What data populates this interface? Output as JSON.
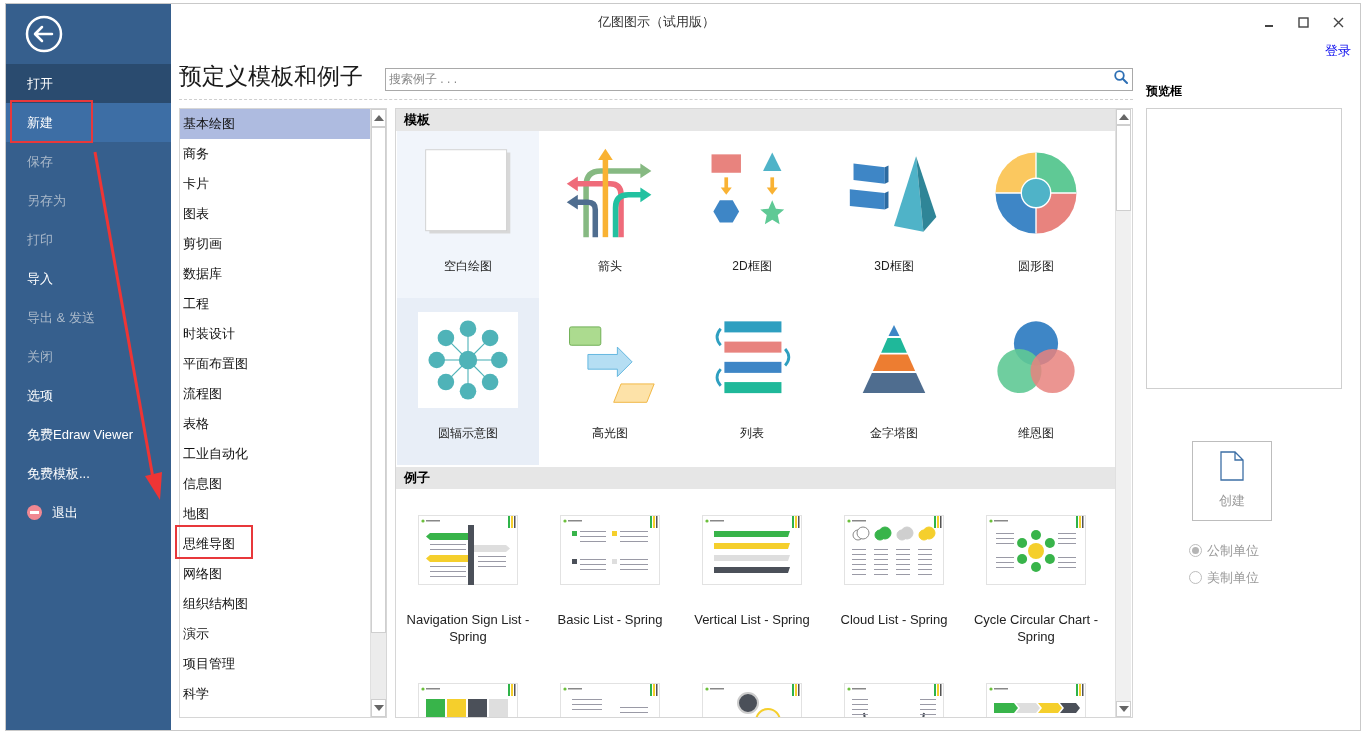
{
  "window": {
    "title": "亿图图示（试用版）"
  },
  "sidebar": {
    "items": [
      {
        "label": "打开",
        "kind": "item",
        "selected": false,
        "hovered": true,
        "disabled": false,
        "highlighted": false
      },
      {
        "label": "新建",
        "kind": "item",
        "selected": true,
        "hovered": false,
        "disabled": false,
        "highlighted": true
      },
      {
        "label": "保存",
        "kind": "item",
        "selected": false,
        "hovered": false,
        "disabled": true,
        "highlighted": false
      },
      {
        "label": "另存为",
        "kind": "item",
        "selected": false,
        "hovered": false,
        "disabled": true,
        "highlighted": false
      },
      {
        "label": "打印",
        "kind": "item",
        "selected": false,
        "hovered": false,
        "disabled": true,
        "highlighted": false
      },
      {
        "label": "导入",
        "kind": "item",
        "selected": false,
        "hovered": false,
        "disabled": false,
        "highlighted": false
      },
      {
        "label": "导出 & 发送",
        "kind": "item",
        "selected": false,
        "hovered": false,
        "disabled": true,
        "highlighted": false
      },
      {
        "label": "关闭",
        "kind": "item",
        "selected": false,
        "hovered": false,
        "disabled": true,
        "highlighted": false
      },
      {
        "label": "选项",
        "kind": "item",
        "selected": false,
        "hovered": false,
        "disabled": false,
        "highlighted": false
      },
      {
        "label": "免费Edraw Viewer",
        "kind": "item",
        "selected": false,
        "hovered": false,
        "disabled": false,
        "highlighted": false
      },
      {
        "label": "免费模板...",
        "kind": "item",
        "selected": false,
        "hovered": false,
        "disabled": false,
        "highlighted": false
      },
      {
        "label": "退出",
        "kind": "exit",
        "selected": false,
        "hovered": false,
        "disabled": false,
        "highlighted": false
      }
    ]
  },
  "header": {
    "title": "预定义模板和例子",
    "search": {
      "placeholder": "搜索例子 . . ."
    }
  },
  "categories": [
    {
      "label": "基本绘图",
      "selected": true,
      "highlighted": false
    },
    {
      "label": "商务",
      "selected": false,
      "highlighted": false
    },
    {
      "label": "卡片",
      "selected": false,
      "highlighted": false
    },
    {
      "label": "图表",
      "selected": false,
      "highlighted": false
    },
    {
      "label": "剪切画",
      "selected": false,
      "highlighted": false
    },
    {
      "label": "数据库",
      "selected": false,
      "highlighted": false
    },
    {
      "label": "工程",
      "selected": false,
      "highlighted": false
    },
    {
      "label": "时装设计",
      "selected": false,
      "highlighted": false
    },
    {
      "label": "平面布置图",
      "selected": false,
      "highlighted": false
    },
    {
      "label": "流程图",
      "selected": false,
      "highlighted": false
    },
    {
      "label": "表格",
      "selected": false,
      "highlighted": false
    },
    {
      "label": "工业自动化",
      "selected": false,
      "highlighted": false
    },
    {
      "label": "信息图",
      "selected": false,
      "highlighted": false
    },
    {
      "label": "地图",
      "selected": false,
      "highlighted": false
    },
    {
      "label": "思维导图",
      "selected": false,
      "highlighted": true
    },
    {
      "label": "网络图",
      "selected": false,
      "highlighted": false
    },
    {
      "label": "组织结构图",
      "selected": false,
      "highlighted": false
    },
    {
      "label": "演示",
      "selected": false,
      "highlighted": false
    },
    {
      "label": "项目管理",
      "selected": false,
      "highlighted": false
    },
    {
      "label": "科学",
      "selected": false,
      "highlighted": false
    }
  ],
  "templates": {
    "heading": "模板",
    "items": [
      {
        "label": "空白绘图",
        "kind": "blank",
        "selected": false,
        "hovered": true
      },
      {
        "label": "箭头",
        "kind": "arrows",
        "selected": false,
        "hovered": false
      },
      {
        "label": "2D框图",
        "kind": "blocks2d",
        "selected": false,
        "hovered": false
      },
      {
        "label": "3D框图",
        "kind": "blocks3d",
        "selected": false,
        "hovered": false
      },
      {
        "label": "圆形图",
        "kind": "circle",
        "selected": false,
        "hovered": false
      },
      {
        "label": "圆辐示意图",
        "kind": "spoke",
        "selected": true,
        "hovered": false
      },
      {
        "label": "高光图",
        "kind": "highlight",
        "selected": false,
        "hovered": false
      },
      {
        "label": "列表",
        "kind": "list",
        "selected": false,
        "hovered": false
      },
      {
        "label": "金字塔图",
        "kind": "pyramid",
        "selected": false,
        "hovered": false
      },
      {
        "label": "维恩图",
        "kind": "venn",
        "selected": false,
        "hovered": false
      }
    ]
  },
  "examples": {
    "heading": "例子",
    "items": [
      {
        "title": "Navigation Sign List - Spring",
        "kind": "sign"
      },
      {
        "title": "Basic List - Spring",
        "kind": "list"
      },
      {
        "title": "Vertical List - Spring",
        "kind": "vertical"
      },
      {
        "title": "Cloud List - Spring",
        "kind": "cloud"
      },
      {
        "title": "Cycle Circular Chart - Spring",
        "kind": "cycle"
      },
      {
        "kind": "columns"
      },
      {
        "kind": "pie"
      },
      {
        "kind": "circles"
      },
      {
        "kind": "frame"
      },
      {
        "kind": "chevrons"
      }
    ]
  },
  "login": "登录",
  "preview": {
    "title": "预览框"
  },
  "create_button": {
    "label": "创建",
    "disabled": true
  },
  "units": [
    {
      "label": "公制单位",
      "selected": true,
      "disabled": true
    },
    {
      "label": "美制单位",
      "selected": false,
      "disabled": true
    }
  ],
  "annotations": {
    "arrow": true
  }
}
